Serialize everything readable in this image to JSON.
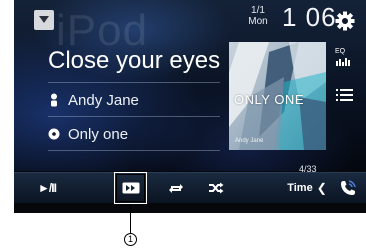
{
  "watermark": "iPod",
  "clock": {
    "date_top": "1/1",
    "date_bottom": "Mon",
    "time": "1 06"
  },
  "track": {
    "title": "Close your eyes",
    "artist": "Andy Jane",
    "album": "Only one",
    "counter": "4/33"
  },
  "album_art": {
    "title_text": "ONLY ONE",
    "artist_text": "Andy Jane"
  },
  "side_buttons": {
    "eq_label": "EQ"
  },
  "control_bar": {
    "play_pause_label": "►/II",
    "time_label": "Time",
    "time_chevron": "❮"
  },
  "callout": {
    "number": "①"
  },
  "icons": {
    "source": "source-icon",
    "settings": "gear-icon",
    "eq": "eq-icon",
    "list": "list-icon",
    "artist": "person-icon",
    "album": "disc-icon",
    "link_search": "link-search-icon",
    "repeat": "repeat-icon",
    "shuffle": "shuffle-icon",
    "phone": "phone-icon"
  },
  "colors": {
    "background": "#0a1324",
    "control_bar": "#132236",
    "text": "#ffffff",
    "accent_blue": "#4f7bd8"
  }
}
